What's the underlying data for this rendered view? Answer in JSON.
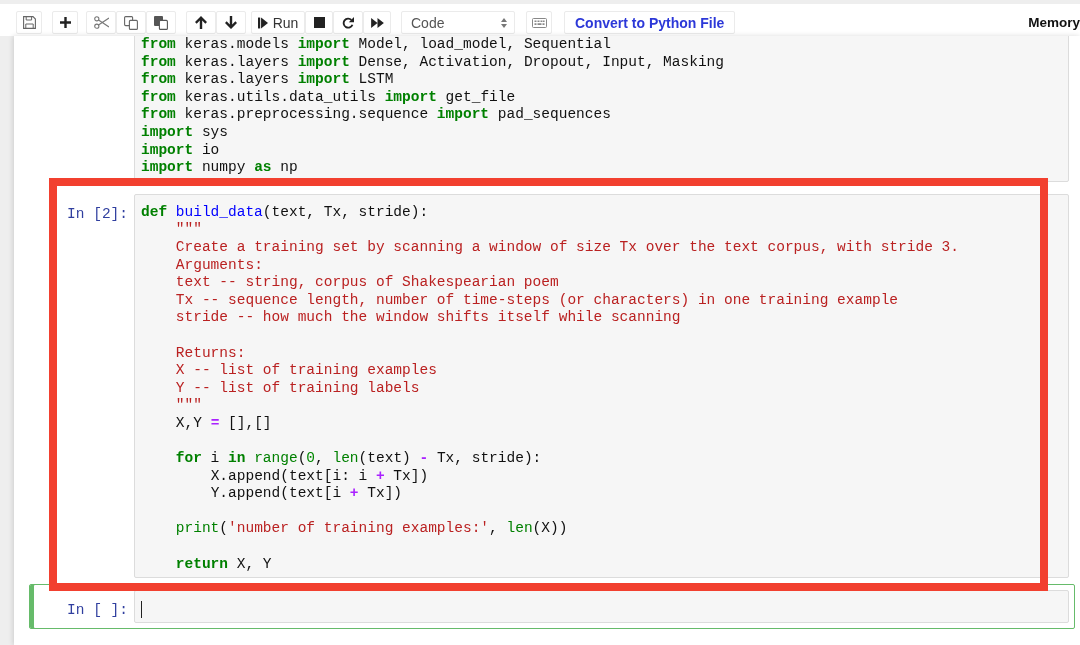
{
  "toolbar": {
    "run_label": "Run",
    "cell_type": "Code",
    "convert_button": "Convert to Python File",
    "memory_label": "Memory"
  },
  "cells": [
    {
      "selected": false,
      "highlighted": false,
      "code_blocks": [
        [
          [
            {
              "kind": "keyword",
              "text": "from"
            },
            {
              "kind": "plain",
              "text": " keras.models "
            },
            {
              "kind": "keyword",
              "text": "import"
            },
            {
              "kind": "plain",
              "text": " Model, load_model, Sequential"
            }
          ],
          [
            {
              "kind": "keyword",
              "text": "from"
            },
            {
              "kind": "plain",
              "text": " keras.layers "
            },
            {
              "kind": "keyword",
              "text": "import"
            },
            {
              "kind": "plain",
              "text": " Dense, Activation, Dropout, Input, Masking"
            }
          ],
          [
            {
              "kind": "keyword",
              "text": "from"
            },
            {
              "kind": "plain",
              "text": " keras.layers "
            },
            {
              "kind": "keyword",
              "text": "import"
            },
            {
              "kind": "plain",
              "text": " LSTM"
            }
          ],
          [
            {
              "kind": "keyword",
              "text": "from"
            },
            {
              "kind": "plain",
              "text": " keras.utils.data_utils "
            },
            {
              "kind": "keyword",
              "text": "import"
            },
            {
              "kind": "plain",
              "text": " get_file"
            }
          ],
          [
            {
              "kind": "keyword",
              "text": "from"
            },
            {
              "kind": "plain",
              "text": " keras.preprocessing.sequence "
            },
            {
              "kind": "keyword",
              "text": "import"
            },
            {
              "kind": "plain",
              "text": " pad_sequences"
            }
          ],
          [
            {
              "kind": "keyword",
              "text": "import"
            },
            {
              "kind": "plain",
              "text": " sys"
            }
          ],
          [
            {
              "kind": "keyword",
              "text": "import"
            },
            {
              "kind": "plain",
              "text": " io"
            }
          ],
          [
            {
              "kind": "keyword",
              "text": "import"
            },
            {
              "kind": "plain",
              "text": " numpy "
            },
            {
              "kind": "keyword",
              "text": "as"
            },
            {
              "kind": "plain",
              "text": " np"
            }
          ]
        ]
      ]
    },
    {
      "prompt": "In [2]:",
      "selected": false,
      "highlighted": true,
      "code_blocks": [
        [
          [
            {
              "kind": "keyword",
              "text": "def"
            },
            {
              "kind": "function",
              "text": " build_data"
            },
            {
              "kind": "plain",
              "text": "(text, Tx, stride):"
            }
          ],
          [
            {
              "kind": "string",
              "text": "    \"\"\""
            }
          ],
          [
            {
              "kind": "string",
              "text": "    Create a training set by scanning a window of size Tx over the text corpus, with stride 3."
            }
          ],
          [
            {
              "kind": "string",
              "text": "    Arguments:"
            }
          ],
          [
            {
              "kind": "string",
              "text": "    text -- string, corpus of Shakespearian poem"
            }
          ],
          [
            {
              "kind": "string",
              "text": "    Tx -- sequence length, number of time-steps (or characters) in one training example"
            }
          ],
          [
            {
              "kind": "string",
              "text": "    stride -- how much the window shifts itself while scanning"
            }
          ]
        ],
        [
          [
            {
              "kind": "string",
              "text": "    Returns:"
            }
          ],
          [
            {
              "kind": "string",
              "text": "    X -- list of training examples"
            }
          ],
          [
            {
              "kind": "string",
              "text": "    Y -- list of training labels"
            }
          ],
          [
            {
              "kind": "string",
              "text": "    \"\"\""
            }
          ],
          [
            {
              "kind": "plain",
              "text": "    X,Y "
            },
            {
              "kind": "operator",
              "text": "="
            },
            {
              "kind": "plain",
              "text": " [],[]"
            }
          ]
        ],
        [
          [
            {
              "kind": "keyword",
              "text": "    for"
            },
            {
              "kind": "plain",
              "text": " i "
            },
            {
              "kind": "keyword",
              "text": "in"
            },
            {
              "kind": "builtin",
              "text": " range"
            },
            {
              "kind": "plain",
              "text": "("
            },
            {
              "kind": "number",
              "text": "0"
            },
            {
              "kind": "plain",
              "text": ", "
            },
            {
              "kind": "builtin",
              "text": "len"
            },
            {
              "kind": "plain",
              "text": "(text) "
            },
            {
              "kind": "operator",
              "text": "-"
            },
            {
              "kind": "plain",
              "text": " Tx, stride):"
            }
          ],
          [
            {
              "kind": "plain",
              "text": "        X.append(text[i: i "
            },
            {
              "kind": "operator",
              "text": "+"
            },
            {
              "kind": "plain",
              "text": " Tx])"
            }
          ],
          [
            {
              "kind": "plain",
              "text": "        Y.append(text[i "
            },
            {
              "kind": "operator",
              "text": "+"
            },
            {
              "kind": "plain",
              "text": " Tx])"
            }
          ]
        ],
        [
          [
            {
              "kind": "builtin",
              "text": "    print"
            },
            {
              "kind": "plain",
              "text": "("
            },
            {
              "kind": "string",
              "text": "'number of training examples:'"
            },
            {
              "kind": "plain",
              "text": ", "
            },
            {
              "kind": "builtin",
              "text": "len"
            },
            {
              "kind": "plain",
              "text": "(X))"
            }
          ]
        ],
        [
          [
            {
              "kind": "keyword",
              "text": "    return"
            },
            {
              "kind": "plain",
              "text": " X, Y"
            }
          ]
        ]
      ]
    },
    {
      "prompt": "In [ ]:",
      "selected": true,
      "highlighted": false
    }
  ]
}
